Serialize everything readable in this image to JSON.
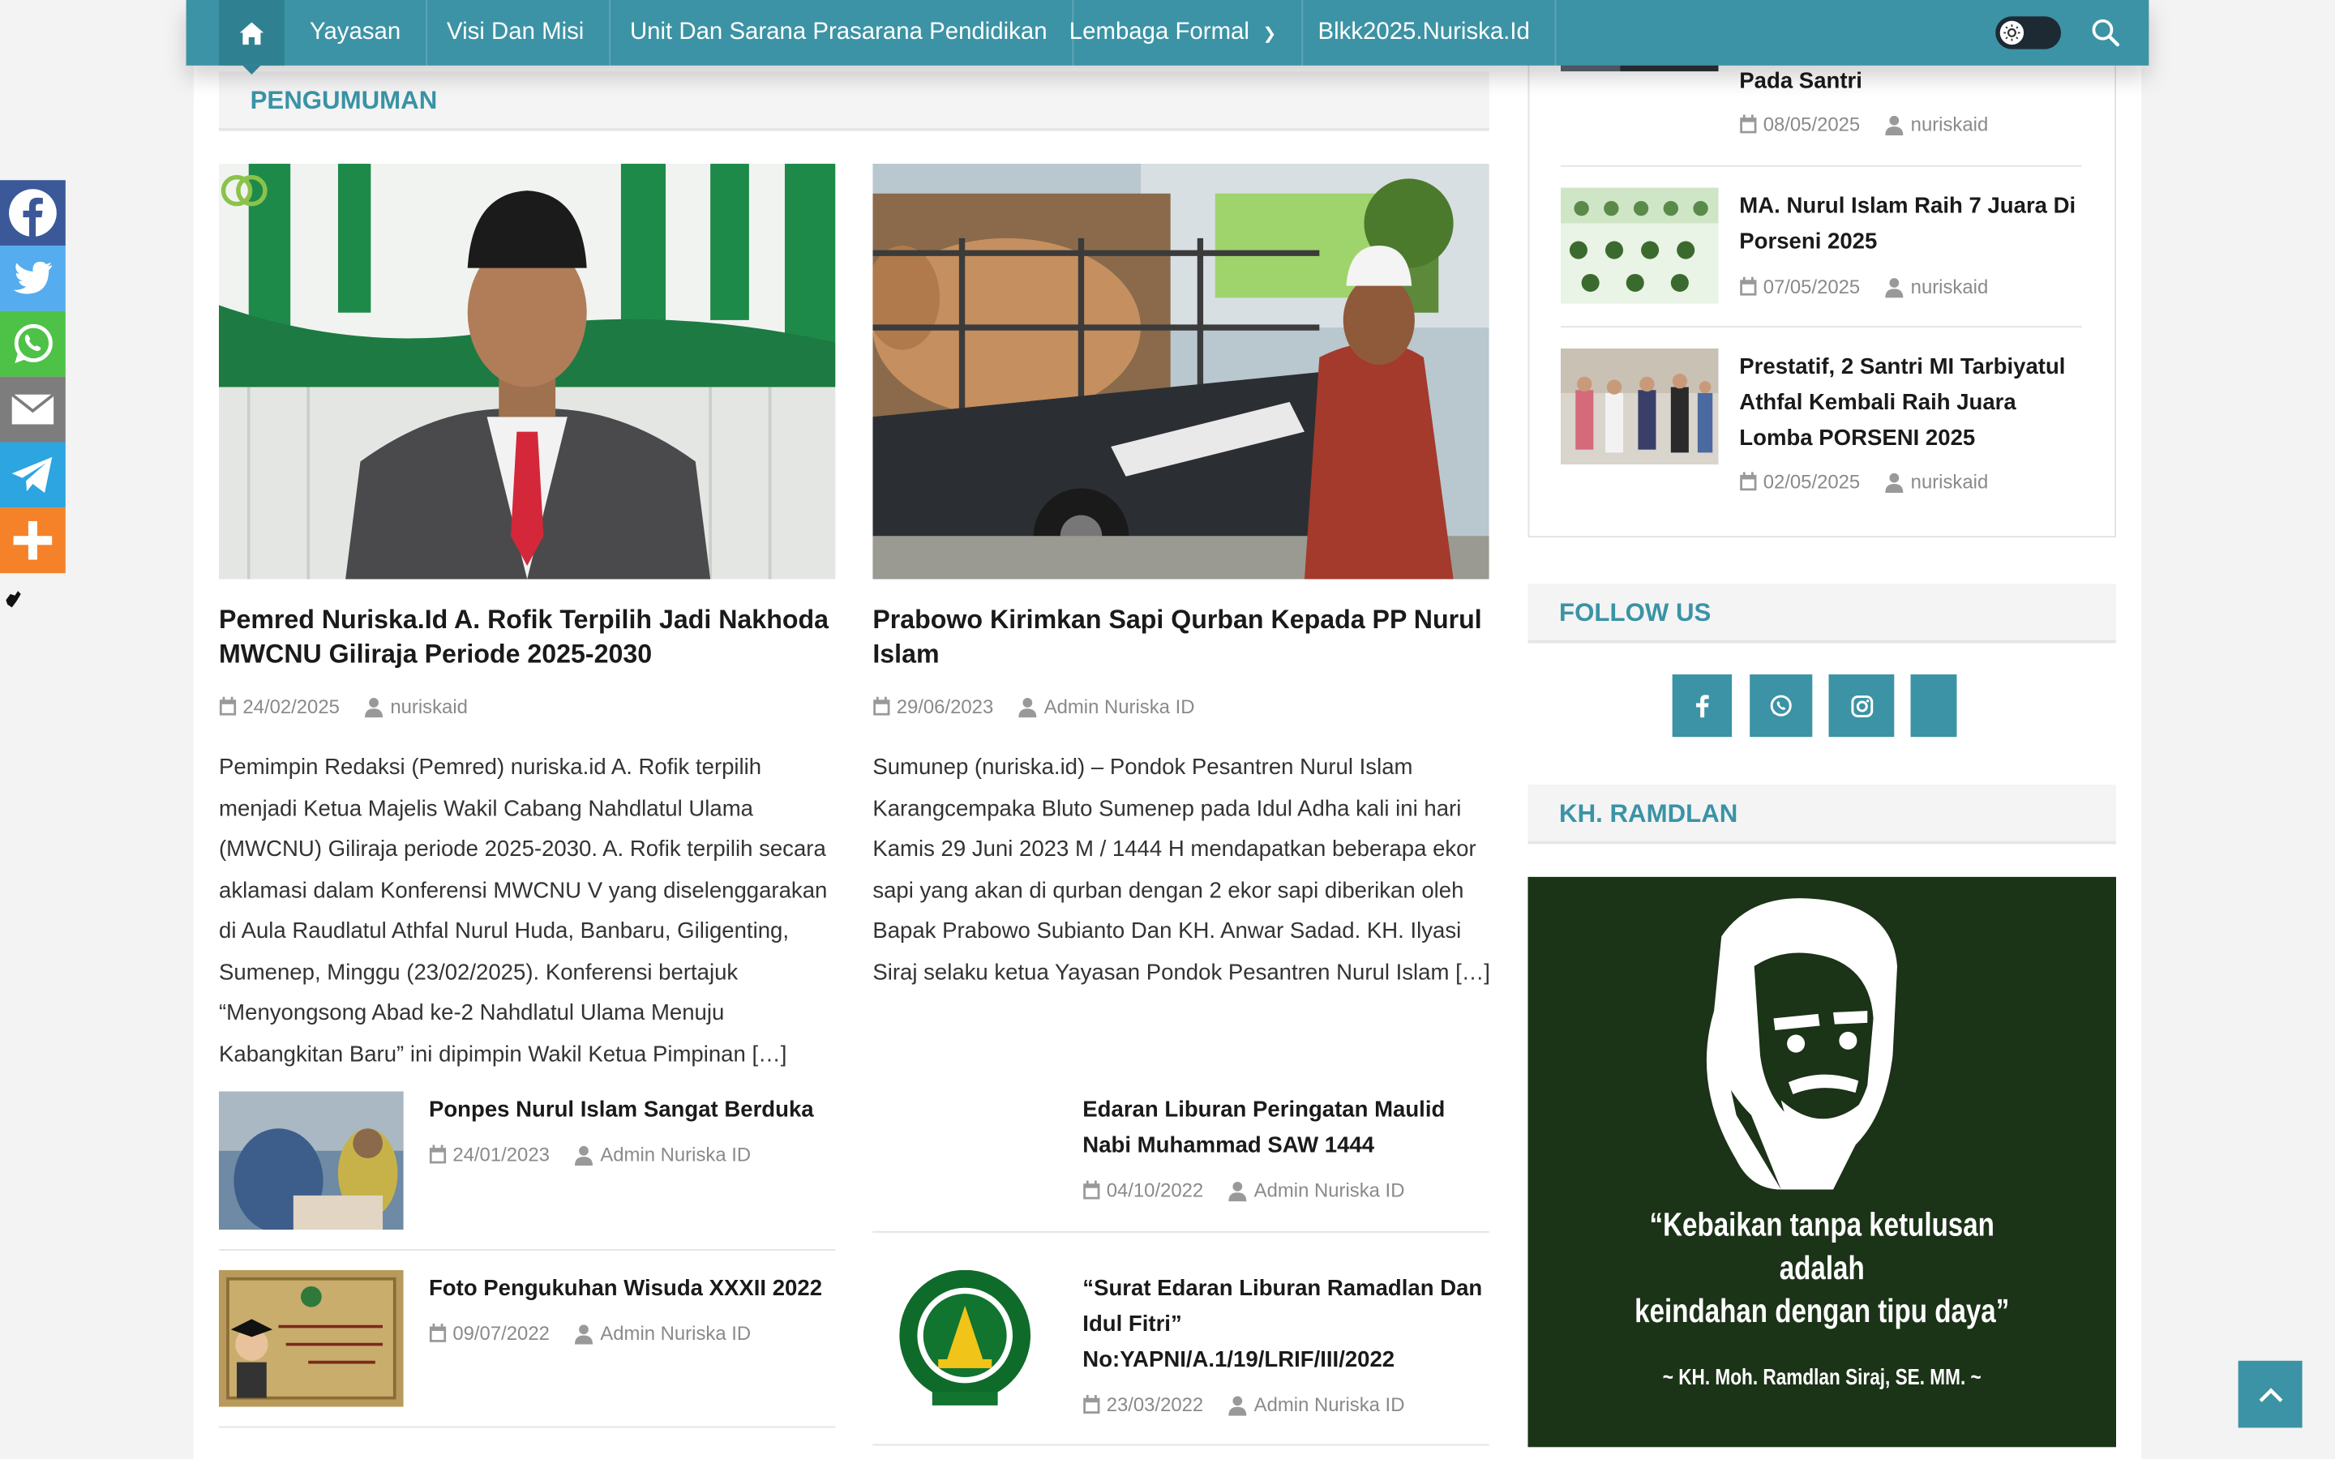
{
  "nav": {
    "items": [
      "Yayasan",
      "Visi Dan Misi",
      "Unit Dan Sarana Prasarana Pendidikan",
      "Lembaga Formal",
      "Blkk2025.Nuriska.Id"
    ]
  },
  "pengumuman": {
    "heading": "PENGUMUMAN",
    "posts": [
      {
        "title": "Pemred Nuriska.Id A. Rofik Terpilih Jadi Nakhoda MWCNU Giliraja Periode 2025-2030",
        "date": "24/02/2025",
        "author": "nuriskaid",
        "excerpt": "Pemimpin Redaksi (Pemred) nuriska.id A. Rofik terpilih menjadi Ketua Majelis Wakil Cabang Nahdlatul Ulama (MWCNU) Giliraja periode 2025-2030. A. Rofik terpilih secara aklamasi dalam Konferensi MWCNU V yang diselenggarakan di Aula Raudlatul Athfal Nurul Huda, Banbaru, Giligenting, Sumenep, Minggu (23/02/2025). Konferensi bertajuk “Menyongsong Abad ke-2 Nahdlatul Ulama Menuju Kabangkitan Baru” ini dipimpin Wakil Ketua Pimpinan […]"
      },
      {
        "title": "Prabowo Kirimkan Sapi Qurban Kepada PP Nurul Islam",
        "date": "29/06/2023",
        "author": "Admin Nuriska ID",
        "excerpt": "Sumunep (nuriska.id) – Pondok Pesantren Nurul Islam Karangcempaka Bluto Sumenep pada Idul Adha kali ini hari Kamis 29 Juni 2023 M / 1444 H mendapatkan beberapa ekor sapi yang akan di qurban dengan 2 ekor sapi diberikan oleh Bapak Prabowo Subianto Dan KH. Anwar Sadad. KH. Ilyasi Siraj selaku ketua Yayasan Pondok Pesantren Nurul Islam […]"
      }
    ],
    "small_posts": [
      {
        "title": "Ponpes Nurul Islam Sangat Berduka",
        "date": "24/01/2023",
        "author": "Admin Nuriska ID"
      },
      {
        "title": "Edaran Liburan Peringatan Maulid Nabi Muhammad SAW 1444",
        "date": "04/10/2022",
        "author": "Admin Nuriska ID"
      },
      {
        "title": "Foto Pengukuhan Wisuda XXXII 2022",
        "date": "09/07/2022",
        "author": "Admin Nuriska ID"
      },
      {
        "title": "“Surat Edaran Liburan Ramadlan Dan Idul Fitri” No:YAPNI/A.1/19/LRIF/III/2022",
        "date": "23/03/2022",
        "author": "Admin Nuriska ID"
      }
    ]
  },
  "sidebar": {
    "recent": [
      {
        "title": "Pada Santri",
        "date": "08/05/2025",
        "author": "nuriskaid"
      },
      {
        "title": "MA. Nurul Islam Raih 7 Juara Di Porseni 2025",
        "date": "07/05/2025",
        "author": "nuriskaid"
      },
      {
        "title": "Prestatif, 2 Santri MI Tarbiyatul Athfal Kembali Raih Juara Lomba PORSENI 2025",
        "date": "02/05/2025",
        "author": "nuriskaid"
      }
    ],
    "follow_heading": "FOLLOW US",
    "follow_icons": [
      "facebook-icon",
      "whatsapp-icon",
      "instagram-icon",
      "blank"
    ],
    "kh_heading": "KH. RAMDLAN",
    "quote_lines": [
      "“Kebaikan tanpa ketulusan",
      "adalah",
      "keindahan dengan tipu daya”"
    ],
    "quote_signature": "~ KH. Moh. Ramdlan Siraj, SE. MM. ~"
  },
  "share": {
    "buttons": [
      {
        "name": "facebook",
        "color": "#3b5998"
      },
      {
        "name": "twitter",
        "color": "#55acee"
      },
      {
        "name": "whatsapp",
        "color": "#4dc247"
      },
      {
        "name": "email",
        "color": "#7d7d7d"
      },
      {
        "name": "telegram",
        "color": "#2ca5e0"
      },
      {
        "name": "more",
        "color": "#f58229"
      }
    ]
  },
  "colors": {
    "accent": "#3c93a5",
    "accent_dark": "#2f8192",
    "heading_text": "#3a93a6"
  }
}
